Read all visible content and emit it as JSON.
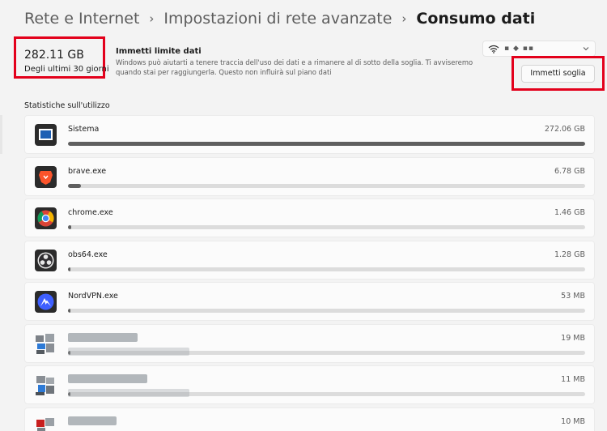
{
  "breadcrumb": {
    "items": [
      "Rete e Internet",
      "Impostazioni di rete avanzate",
      "Consumo dati"
    ],
    "separator": "›"
  },
  "summary": {
    "total": "282.11 GB",
    "period": "Degli ultimi 30 giorni"
  },
  "limit": {
    "title": "Immetti limite dati",
    "description": "Windows può aiutarti a tenere traccia dell'uso dei dati e a rimanere al di sotto della soglia. Ti avviseremo quando stai per raggiungerla. Questo non influirà sul piano dati",
    "button_label": "Immetti soglia"
  },
  "network": {
    "name": "▪ ◆ ▪▪",
    "icon": "wifi-icon"
  },
  "stats": {
    "label": "Statistiche sull'utilizzo",
    "apps": [
      {
        "name": "Sistema",
        "usage": "272.06 GB",
        "fraction": 1.0,
        "icon": "sistema-icon",
        "color": "#1e5fb4"
      },
      {
        "name": "brave.exe",
        "usage": "6.78 GB",
        "fraction": 0.025,
        "icon": "brave-icon",
        "color": "#fb542b"
      },
      {
        "name": "chrome.exe",
        "usage": "1.46 GB",
        "fraction": 0.006,
        "icon": "chrome-icon",
        "color": "#4285f4"
      },
      {
        "name": "obs64.exe",
        "usage": "1.28 GB",
        "fraction": 0.005,
        "icon": "obs-icon",
        "color": "#302e31"
      },
      {
        "name": "NordVPN.exe",
        "usage": "53 MB",
        "fraction": 0.0,
        "icon": "nordvpn-icon",
        "color": "#4687ff"
      },
      {
        "name": "",
        "usage": "19 MB",
        "fraction": 0.0,
        "icon": "redacted-icon",
        "color": "#888888"
      },
      {
        "name": "",
        "usage": "11 MB",
        "fraction": 0.0,
        "icon": "redacted-icon",
        "color": "#888888"
      },
      {
        "name": "",
        "usage": "10 MB",
        "fraction": 0.0,
        "icon": "redacted-icon",
        "color": "#888888"
      }
    ]
  }
}
